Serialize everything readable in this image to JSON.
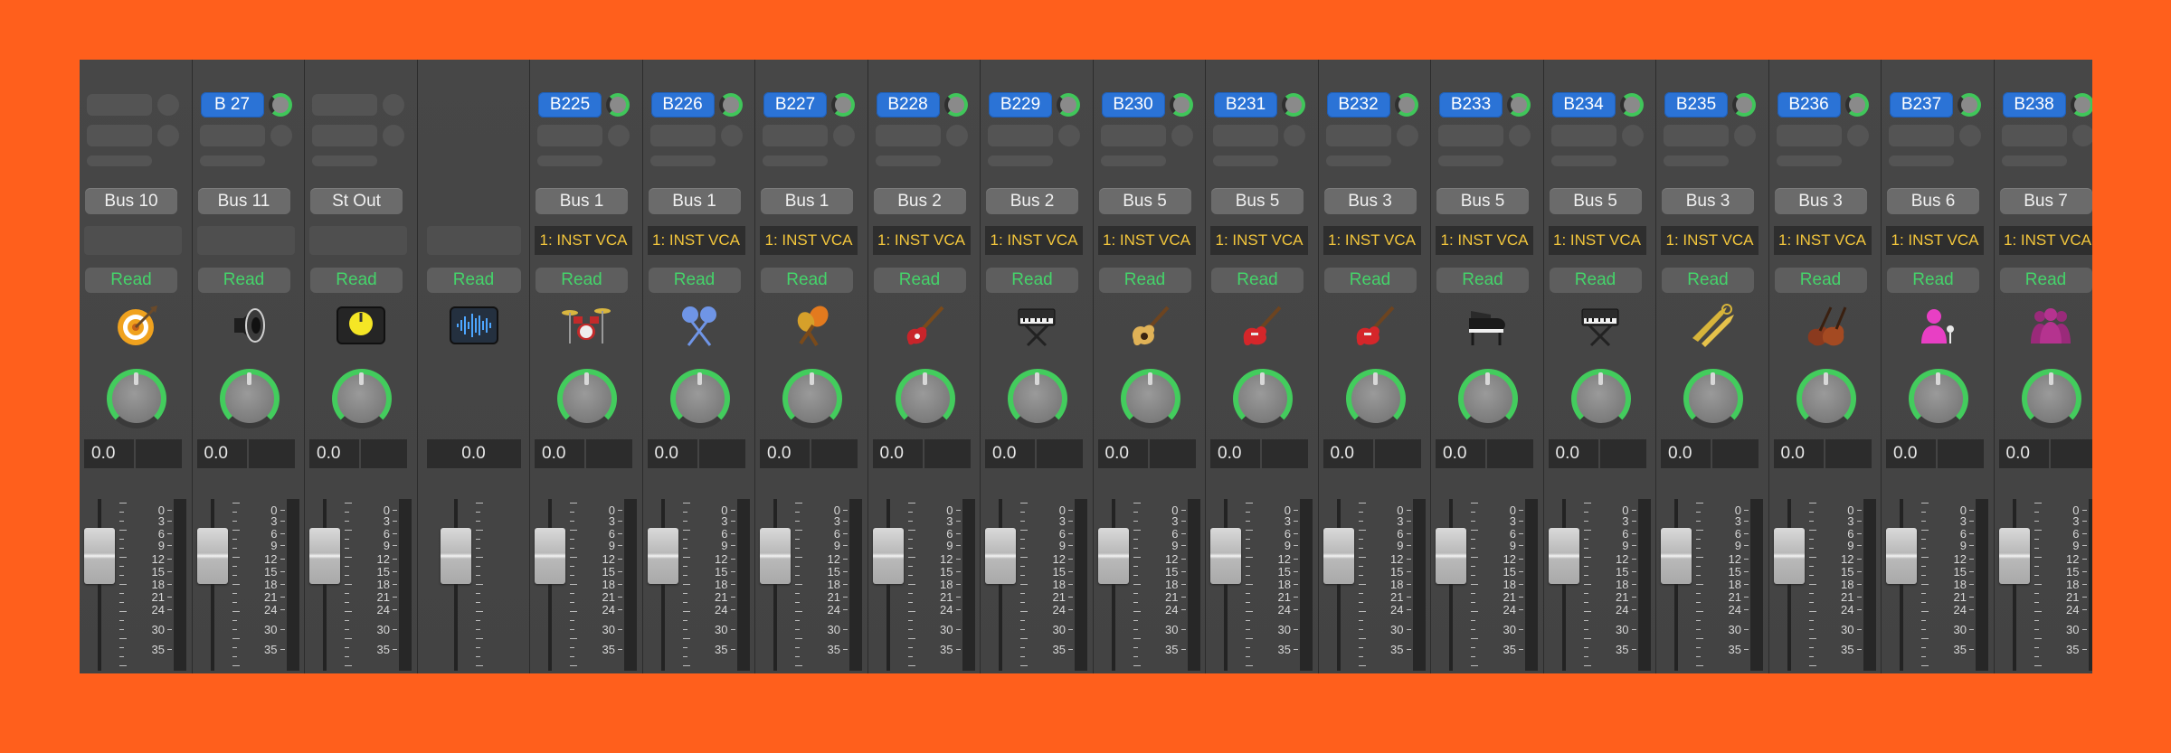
{
  "colors": {
    "background": "#ff5f1c",
    "send_button": "#2b73d6",
    "automation_text": "#45d36a",
    "vca_text": "#f3c63c",
    "pan_ring": "#43cc5d"
  },
  "scale_labels": [
    "0",
    "3",
    "6",
    "9",
    "12",
    "15",
    "18",
    "21",
    "24",
    "30",
    "35"
  ],
  "strips": [
    {
      "send": null,
      "io": "Bus 10",
      "vca": null,
      "automation": "Read",
      "icon": "target-icon",
      "volume": "0.0",
      "show_pan": true,
      "full_volume": false
    },
    {
      "send": "B 27",
      "io": "Bus 11",
      "vca": null,
      "automation": "Read",
      "icon": "speaker-icon",
      "volume": "0.0",
      "show_pan": true,
      "full_volume": false
    },
    {
      "send": null,
      "io": "St Out",
      "vca": null,
      "automation": "Read",
      "icon": "yellow-knob-icon",
      "volume": "0.0",
      "show_pan": true,
      "full_volume": false
    },
    {
      "send": null,
      "io": null,
      "vca": null,
      "automation": "Read",
      "icon": "waveform-icon",
      "volume": "0.0",
      "show_pan": false,
      "full_volume": true
    },
    {
      "send": "B225",
      "io": "Bus 1",
      "vca": "1: INST VCA",
      "automation": "Read",
      "icon": "drum-kit-icon",
      "volume": "0.0",
      "show_pan": true,
      "full_volume": false
    },
    {
      "send": "B226",
      "io": "Bus 1",
      "vca": "1: INST VCA",
      "automation": "Read",
      "icon": "drumsticks-icon",
      "volume": "0.0",
      "show_pan": true,
      "full_volume": false
    },
    {
      "send": "B227",
      "io": "Bus 1",
      "vca": "1: INST VCA",
      "automation": "Read",
      "icon": "maracas-icon",
      "volume": "0.0",
      "show_pan": true,
      "full_volume": false
    },
    {
      "send": "B228",
      "io": "Bus 2",
      "vca": "1: INST VCA",
      "automation": "Read",
      "icon": "bass-guitar-icon",
      "volume": "0.0",
      "show_pan": true,
      "full_volume": false
    },
    {
      "send": "B229",
      "io": "Bus 2",
      "vca": "1: INST VCA",
      "automation": "Read",
      "icon": "synth-keyboard-icon",
      "volume": "0.0",
      "show_pan": true,
      "full_volume": false
    },
    {
      "send": "B230",
      "io": "Bus 5",
      "vca": "1: INST VCA",
      "automation": "Read",
      "icon": "acoustic-guitar-icon",
      "volume": "0.0",
      "show_pan": true,
      "full_volume": false
    },
    {
      "send": "B231",
      "io": "Bus 5",
      "vca": "1: INST VCA",
      "automation": "Read",
      "icon": "electric-guitar-icon",
      "volume": "0.0",
      "show_pan": true,
      "full_volume": false
    },
    {
      "send": "B232",
      "io": "Bus 3",
      "vca": "1: INST VCA",
      "automation": "Read",
      "icon": "electric-guitar-icon",
      "volume": "0.0",
      "show_pan": true,
      "full_volume": false
    },
    {
      "send": "B233",
      "io": "Bus 5",
      "vca": "1: INST VCA",
      "automation": "Read",
      "icon": "grand-piano-icon",
      "volume": "0.0",
      "show_pan": true,
      "full_volume": false
    },
    {
      "send": "B234",
      "io": "Bus 5",
      "vca": "1: INST VCA",
      "automation": "Read",
      "icon": "synth-keyboard-icon",
      "volume": "0.0",
      "show_pan": true,
      "full_volume": false
    },
    {
      "send": "B235",
      "io": "Bus 3",
      "vca": "1: INST VCA",
      "automation": "Read",
      "icon": "horns-icon",
      "volume": "0.0",
      "show_pan": true,
      "full_volume": false
    },
    {
      "send": "B236",
      "io": "Bus 3",
      "vca": "1: INST VCA",
      "automation": "Read",
      "icon": "strings-icon",
      "volume": "0.0",
      "show_pan": true,
      "full_volume": false
    },
    {
      "send": "B237",
      "io": "Bus 6",
      "vca": "1: INST VCA",
      "automation": "Read",
      "icon": "vocalist-icon",
      "volume": "0.0",
      "show_pan": true,
      "full_volume": false
    },
    {
      "send": "B238",
      "io": "Bus 7",
      "vca": "1: INST VCA",
      "automation": "Read",
      "icon": "choir-icon",
      "volume": "0.0",
      "show_pan": true,
      "full_volume": false
    }
  ]
}
